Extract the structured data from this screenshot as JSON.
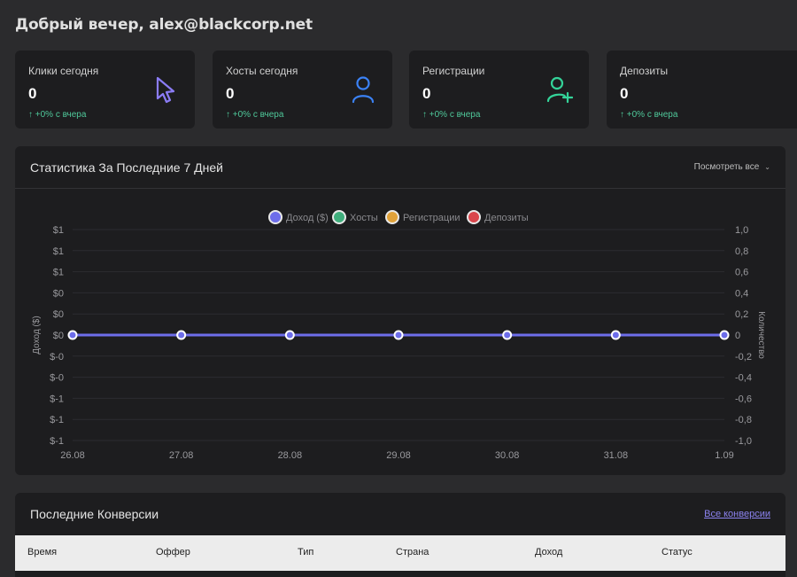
{
  "greeting": "Добрый вечер, alex@blackcorp.net",
  "stats": [
    {
      "label": "Клики сегодня",
      "value": "0",
      "delta": "↑ +0% с вчера",
      "icon": "cursor-icon",
      "color": "#8b7cf6"
    },
    {
      "label": "Хосты сегодня",
      "value": "0",
      "delta": "↑ +0% с вчера",
      "icon": "user-icon",
      "color": "#3b82f6"
    },
    {
      "label": "Регистрации",
      "value": "0",
      "delta": "↑ +0% с вчера",
      "icon": "user-plus-icon",
      "color": "#34d399"
    },
    {
      "label": "Депозиты",
      "value": "0",
      "delta": "↑ +0% с вчера",
      "icon": "",
      "color": ""
    }
  ],
  "chart_panel": {
    "title": "Статистика За Последние 7 Дней",
    "view_all": "Посмотреть все"
  },
  "chart_data": {
    "type": "line",
    "categories": [
      "26.08",
      "27.08",
      "28.08",
      "29.08",
      "30.08",
      "31.08",
      "1.09"
    ],
    "series": [
      {
        "name": "Доход ($)",
        "color": "#6d6dea",
        "values": [
          0,
          0,
          0,
          0,
          0,
          0,
          0
        ],
        "axis": "left"
      },
      {
        "name": "Хосты",
        "color": "#3fae7c",
        "values": [
          0,
          0,
          0,
          0,
          0,
          0,
          0
        ],
        "axis": "right"
      },
      {
        "name": "Регистрации",
        "color": "#e0a23a",
        "values": [
          0,
          0,
          0,
          0,
          0,
          0,
          0
        ],
        "axis": "right"
      },
      {
        "name": "Депозиты",
        "color": "#d9464c",
        "values": [
          0,
          0,
          0,
          0,
          0,
          0,
          0
        ],
        "axis": "right"
      }
    ],
    "ylabel_left": "Доход ($)",
    "ylabel_right": "Количество",
    "left_ticks": [
      "$1",
      "$1",
      "$1",
      "$0",
      "$0",
      "$0",
      "$-0",
      "$-0",
      "$-1",
      "$-1",
      "$-1"
    ],
    "right_ticks": [
      "1,0",
      "0,8",
      "0,6",
      "0,4",
      "0,2",
      "0",
      "-0,2",
      "-0,4",
      "-0,6",
      "-0,8",
      "-1,0"
    ],
    "ylim": [
      -1,
      1
    ],
    "grid": true,
    "legend": "top-center"
  },
  "conversions": {
    "title": "Последние Конверсии",
    "link": "Все конверсии",
    "columns": [
      "Время",
      "Оффер",
      "Тип",
      "Страна",
      "Доход",
      "Статус"
    ]
  }
}
